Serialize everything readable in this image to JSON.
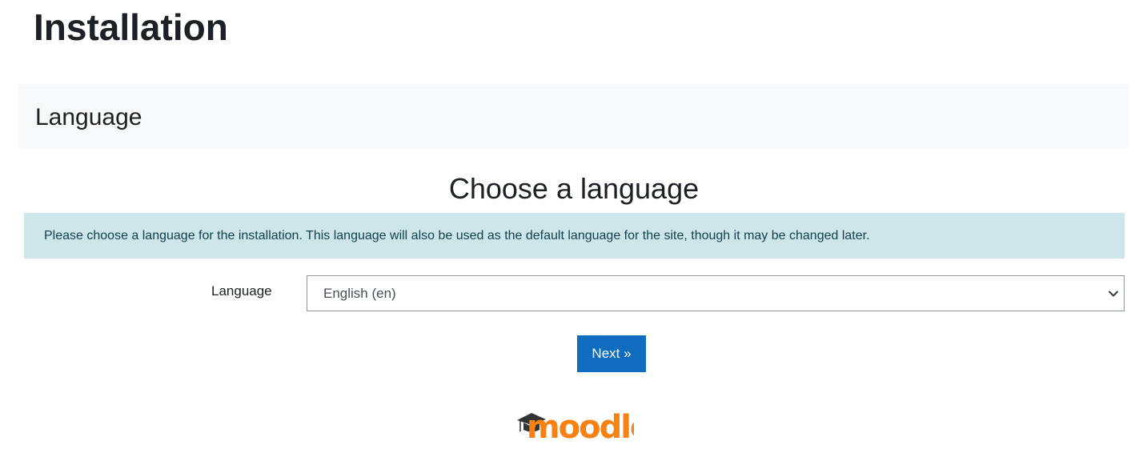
{
  "page": {
    "title": "Installation"
  },
  "stage": {
    "title": "Language"
  },
  "main": {
    "heading": "Choose a language",
    "info_text": "Please choose a language for the installation. This language will also be used as the default language for the site, though it may be changed later.",
    "language_label": "Language",
    "language_selected": "English (en)",
    "next_label": "Next »"
  },
  "footer": {
    "logo_text": "moodle",
    "logo_icon": "graduation-cap-icon"
  },
  "colors": {
    "primary": "#0f6cbf",
    "info_bg": "#cce6ea",
    "info_text": "#14414b",
    "stage_bg": "#f8f9fa",
    "logo_orange": "#f98012",
    "logo_dark": "#333333"
  }
}
